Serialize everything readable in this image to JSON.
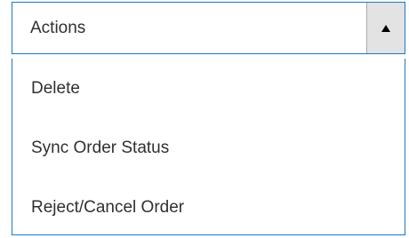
{
  "dropdown": {
    "label": "Actions",
    "caret_icon": "triangle-up-icon",
    "options": [
      {
        "label": "Delete"
      },
      {
        "label": "Sync Order Status"
      },
      {
        "label": "Reject/Cancel Order"
      }
    ]
  },
  "colors": {
    "border_accent": "#1979c3",
    "text": "#303030",
    "caret_bg": "#e3e3e3"
  }
}
